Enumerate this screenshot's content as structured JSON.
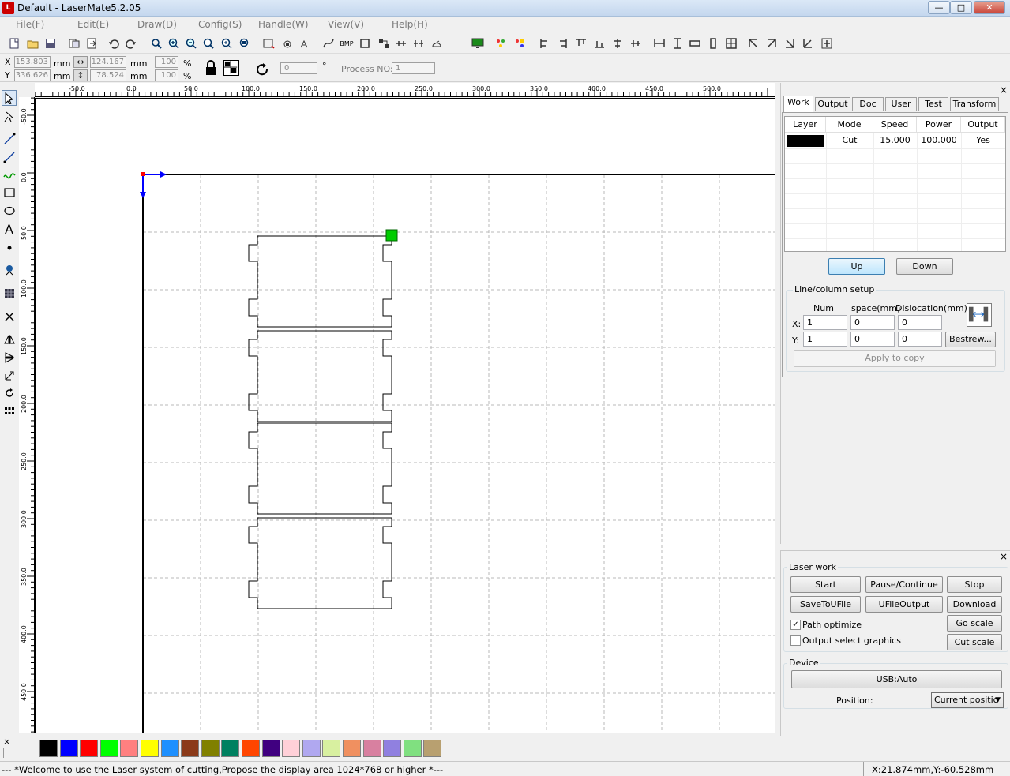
{
  "window": {
    "title": "Default - LaserMate5.2.05",
    "min": "—",
    "max": "□",
    "close": "✕"
  },
  "menu": [
    "File(F)",
    "Edit(E)",
    "Draw(D)",
    "Config(S)",
    "Handle(W)",
    "View(V)",
    "Help(H)"
  ],
  "toolbar2": {
    "x_label": "X",
    "y_label": "Y",
    "x_value": "153.803",
    "y_value": "336.626",
    "unit": "mm",
    "width_value": "124.167",
    "height_value": "78.524",
    "scale_x": "100",
    "scale_y": "100",
    "percent": "%",
    "rotate_value": "0",
    "degree": "°",
    "process_label": "Process NO:",
    "process_value": "1",
    "bmp_label": "BMP"
  },
  "ruler": {
    "h_labels": [
      "-50.0",
      "0.0",
      "50.0",
      "100.0",
      "150.0",
      "200.0",
      "250.0",
      "300.0",
      "350.0",
      "400.0",
      "450.0",
      "500.0"
    ],
    "v_labels": [
      "-50.0",
      "0.0",
      "50.0",
      "100.0",
      "150.0",
      "200.0",
      "250.0",
      "300.0",
      "350.0",
      "400.0",
      "450.0"
    ]
  },
  "tabs": [
    "Work",
    "Output",
    "Doc",
    "User",
    "Test",
    "Transform"
  ],
  "layer_table": {
    "headers": [
      "Layer",
      "Mode",
      "Speed",
      "Power",
      "Output"
    ],
    "rows": [
      {
        "color": "#000000",
        "mode": "Cut",
        "speed": "15.000",
        "power": "100.000",
        "output": "Yes"
      }
    ]
  },
  "layer_buttons": {
    "up": "Up",
    "down": "Down"
  },
  "line_column": {
    "title": "Line/column setup",
    "num": "Num",
    "space": "space(mm)",
    "dislocation": "Dislocation(mm)",
    "x_label": "X:",
    "y_label": "Y:",
    "x_num": "1",
    "x_space": "0",
    "x_disloc": "0",
    "y_num": "1",
    "y_space": "0",
    "y_disloc": "0",
    "bestrew": "Bestrew...",
    "apply": "Apply to copy"
  },
  "laser_work": {
    "title": "Laser work",
    "start": "Start",
    "pause": "Pause/Continue",
    "stop": "Stop",
    "save_u": "SaveToUFile",
    "ufile_output": "UFileOutput",
    "download": "Download",
    "path_optimize": "Path optimize",
    "path_checked": true,
    "output_select": "Output select graphics",
    "output_checked": false,
    "go_scale": "Go scale",
    "cut_scale": "Cut scale"
  },
  "device": {
    "title": "Device",
    "usb": "USB:Auto",
    "position_label": "Position:",
    "position_value": "Current positic"
  },
  "palette": [
    "#000000",
    "#0000ff",
    "#ff0000",
    "#00ff00",
    "#ff8080",
    "#ffff00",
    "#1e90ff",
    "#8b3a1a",
    "#808000",
    "#008060",
    "#ff4500",
    "#400080",
    "#ffd0d8",
    "#b0a8f0",
    "#d8f0a0",
    "#f09060",
    "#d880a0",
    "#9080e0",
    "#80e080",
    "#b8a070"
  ],
  "palette_close": "×",
  "status": {
    "message": "--- *Welcome to use the Laser system of cutting,Propose the display area 1024*768 or higher *---",
    "coords": "X:21.874mm,Y:-60.528mm"
  },
  "colors": {
    "selection": "#00cc00",
    "origin_x": "#0000ff",
    "origin_y": "#0000ff",
    "origin_dot": "#ff0000"
  }
}
